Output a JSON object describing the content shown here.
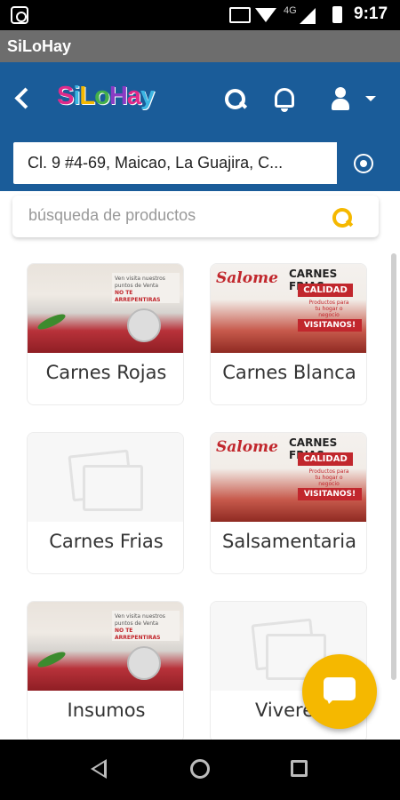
{
  "status_bar": {
    "network": "4G",
    "time": "9:17"
  },
  "app_title": "SiLoHay",
  "header": {
    "logo_text": "SiLoHay",
    "logo_colors": [
      "#e02a8a",
      "#3cb6e3",
      "#f5b800",
      "#43b04a",
      "#8a3cc4"
    ]
  },
  "address": {
    "value": "Cl. 9 #4-69, Maicao, La Guajira, C..."
  },
  "search": {
    "placeholder": "búsqueda de productos"
  },
  "categories": [
    {
      "label": "Carnes Rojas",
      "image": "meat"
    },
    {
      "label": "Carnes Blanca",
      "image": "promo"
    },
    {
      "label": "Carnes Frias",
      "image": "placeholder"
    },
    {
      "label": "Salsamentaria",
      "image": "promo"
    },
    {
      "label": "Insumos",
      "image": "meat"
    },
    {
      "label": "Viveres",
      "image": "placeholder"
    }
  ],
  "promo_image": {
    "brand": "Salome",
    "headline": "CARNES FRIAS",
    "badge": "CALIDAD",
    "subtitle": "Productos para tu hogar o negocio",
    "cta": "VISITANOS!"
  },
  "meat_image": {
    "tagline": "Ven visita nuestros puntos de Venta",
    "highlight": "NO TE ARREPENTIRAS"
  },
  "colors": {
    "primary": "#1a5c99",
    "accent": "#f5b800",
    "title_bar": "#6d6d6d"
  }
}
